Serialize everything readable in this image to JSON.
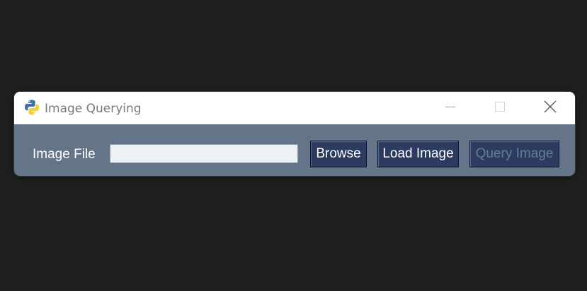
{
  "window": {
    "title": "Image Querying",
    "icon": "python-logo-icon",
    "controls": {
      "minimize": "minimize-icon",
      "maximize": "maximize-icon",
      "close": "close-icon"
    }
  },
  "form": {
    "image_file_label": "Image File",
    "image_file_value": "",
    "image_file_placeholder": ""
  },
  "buttons": {
    "browse": "Browse",
    "load_image": "Load Image",
    "query_image": "Query Image",
    "query_image_enabled": false
  },
  "colors": {
    "background": "#1f1f1f",
    "titlebar": "#ffffff",
    "content_bg": "#647589",
    "button_bg": "#2b3c60",
    "button_text": "#ffffff",
    "disabled_text": "#6b7a94",
    "input_bg": "#eef1f5"
  }
}
